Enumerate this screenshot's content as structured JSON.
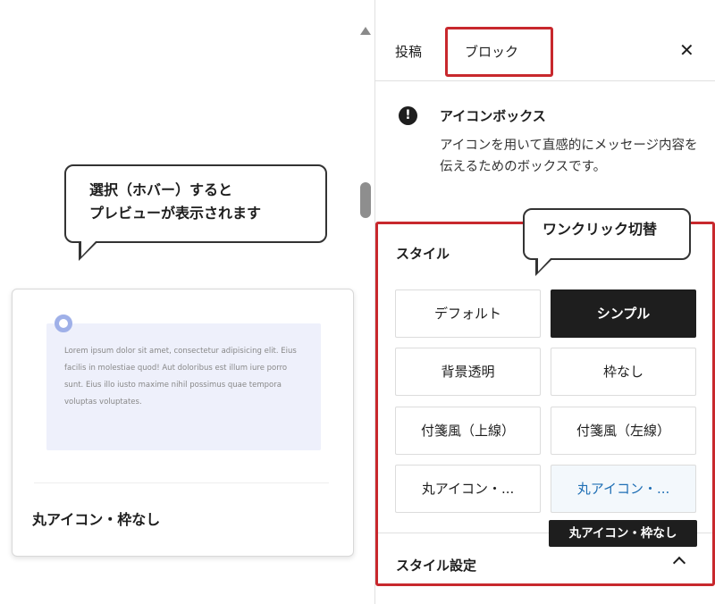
{
  "annotations": {
    "preview_hint_line1": "選択（ホバー）すると",
    "preview_hint_line2": "プレビューが表示されます",
    "one_click_switch": "ワンクリック切替"
  },
  "preview": {
    "body_text": "Lorem ipsum dolor sit amet, consectetur adipisicing elit. Eius facilis in molestiae quod! Aut doloribus est illum iure porro sunt. Eius illo iusto maxime nihil possimus quae tempora voluptas voluptates.",
    "style_label": "丸アイコン・枠なし"
  },
  "sidebar": {
    "tabs": [
      {
        "label": "投稿",
        "selected": false
      },
      {
        "label": "ブロック",
        "selected": true
      }
    ],
    "close_icon": "close-icon",
    "block": {
      "icon": "exclamation-circle-icon",
      "icon_glyph": "!",
      "title": "アイコンボックス",
      "description": "アイコンを用いて直感的にメッセージ内容を伝えるためのボックスです。"
    },
    "styles": {
      "heading": "スタイル",
      "options": [
        {
          "label": "デフォルト",
          "state": "normal"
        },
        {
          "label": "シンプル",
          "state": "active"
        },
        {
          "label": "背景透明",
          "state": "normal"
        },
        {
          "label": "枠なし",
          "state": "normal"
        },
        {
          "label": "付箋風（上線）",
          "state": "normal"
        },
        {
          "label": "付箋風（左線）",
          "state": "normal"
        },
        {
          "label": "丸アイコン・...",
          "state": "normal"
        },
        {
          "label": "丸アイコン・...",
          "state": "hover"
        }
      ],
      "tooltip": "丸アイコン・枠なし"
    },
    "style_settings": {
      "title": "スタイル設定",
      "expanded": true
    }
  },
  "colors": {
    "highlight_red": "#c8282d",
    "active_bg": "#1e1e1e",
    "hover_text": "#1f6fb5",
    "preview_bg": "#eef0fb",
    "preview_icon": "#9fb0e8"
  }
}
